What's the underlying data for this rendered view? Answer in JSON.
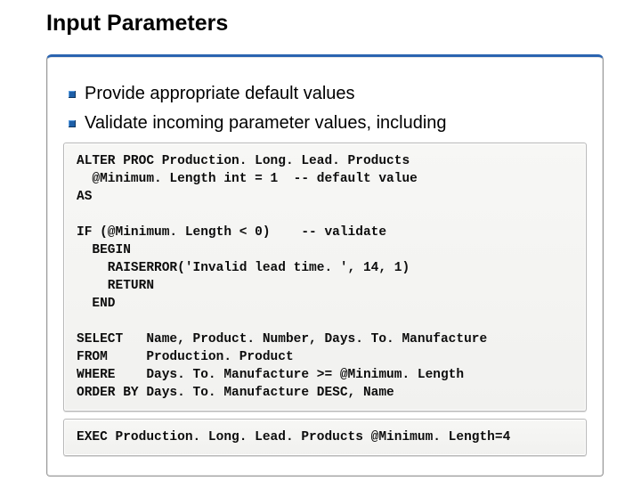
{
  "title": "Input Parameters",
  "bullets": [
    "Provide appropriate default values",
    "Validate incoming parameter values, including"
  ],
  "code_main": "ALTER PROC Production. Long. Lead. Products\n  @Minimum. Length int = 1  -- default value\nAS\n\nIF (@Minimum. Length < 0)    -- validate\n  BEGIN\n    RAISERROR('Invalid lead time. ', 14, 1)\n    RETURN\n  END\n\nSELECT   Name, Product. Number, Days. To. Manufacture\nFROM     Production. Product\nWHERE    Days. To. Manufacture >= @Minimum. Length\nORDER BY Days. To. Manufacture DESC, Name",
  "code_exec": "EXEC Production. Long. Lead. Products @Minimum. Length=4"
}
